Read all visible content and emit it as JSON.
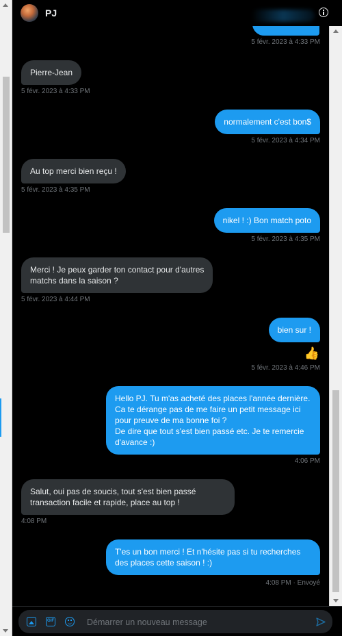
{
  "header": {
    "contact_name": "PJ"
  },
  "messages": [
    {
      "id": "m0",
      "direction": "out",
      "text": "",
      "meta": "5 févr. 2023 à 4:33 PM"
    },
    {
      "id": "m1",
      "direction": "in",
      "text": "Pierre-Jean",
      "meta": "5 févr. 2023 à 4:33 PM"
    },
    {
      "id": "m2",
      "direction": "out",
      "text": "normalement c'est bon$",
      "meta": "5 févr. 2023 à 4:34 PM"
    },
    {
      "id": "m3",
      "direction": "in",
      "text": "Au top merci bien reçu !",
      "meta": "5 févr. 2023 à 4:35 PM"
    },
    {
      "id": "m4",
      "direction": "out",
      "text": "nikel ! :) Bon match poto",
      "meta": "5 févr. 2023 à 4:35 PM"
    },
    {
      "id": "m5",
      "direction": "in",
      "text": "Merci ! Je peux garder ton contact pour d'autres\nmatchs dans la saison ?",
      "meta": "5 févr. 2023 à 4:44 PM"
    },
    {
      "id": "m6",
      "direction": "out",
      "text": "bien sur !",
      "emoji": "👍",
      "meta": "5 févr. 2023 à 4:46 PM"
    },
    {
      "id": "m7",
      "direction": "out",
      "text": "Hello PJ. Tu m'as acheté des places l'année dernière.\nCa te dérange pas de me faire un petit message ici\npour preuve de ma bonne foi ?\nDe dire que tout s'est bien passé etc. Je te remercie\nd'avance :)",
      "meta": "4:06 PM"
    },
    {
      "id": "m8",
      "direction": "in",
      "text": "Salut, oui pas de soucis, tout s'est bien passé\ntransaction facile et rapide, place au top !",
      "meta": "4:08 PM"
    },
    {
      "id": "m9",
      "direction": "out",
      "text": "T'es un bon merci ! Et n'hésite pas si tu recherches\ndes places cette saison ! :)",
      "meta": "4:08 PM · Envoyé"
    }
  ],
  "composer": {
    "placeholder": "Démarrer un nouveau message",
    "value": "",
    "gif_label": "GIF"
  },
  "icons": {
    "header": [
      "avatar",
      "info-icon"
    ],
    "composer": [
      "image-icon",
      "gif-icon",
      "emoji-icon",
      "send-icon"
    ]
  },
  "colors": {
    "outgoing_bubble": "#1d9bf0",
    "incoming_bubble": "#2f3336",
    "background": "#000000",
    "meta_text": "#71767b",
    "composer_bg": "#202327"
  }
}
